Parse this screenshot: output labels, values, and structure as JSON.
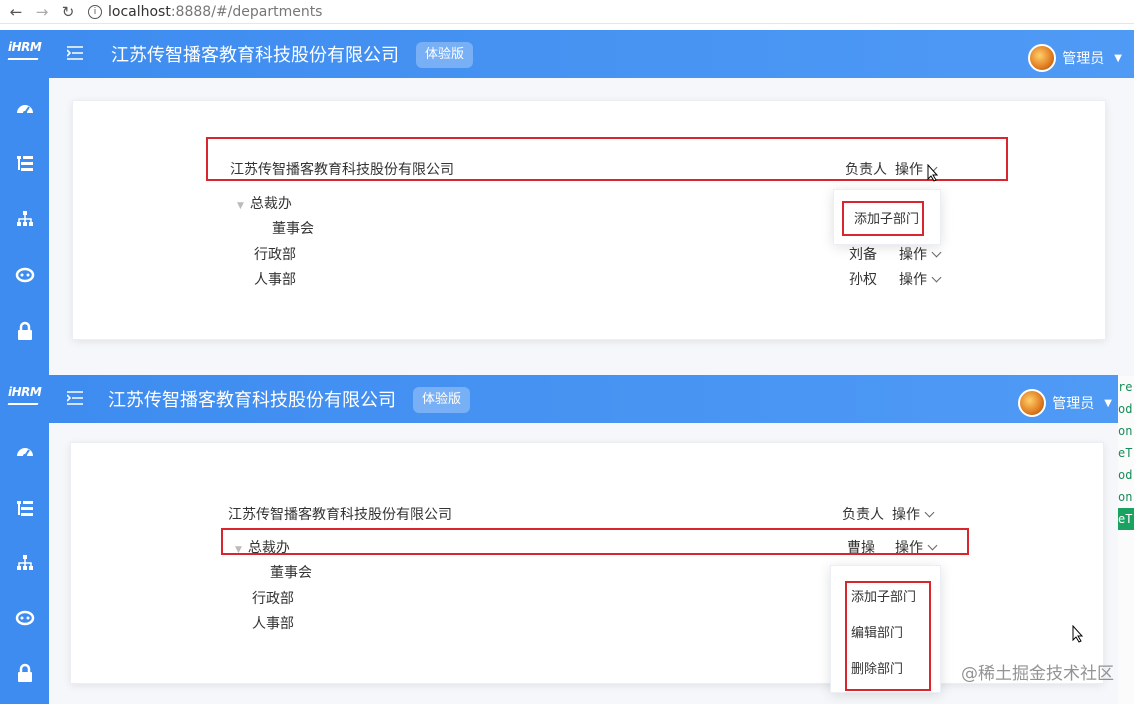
{
  "browser": {
    "back": "←",
    "forward": "→",
    "reload": "↻",
    "url_host": "localhost",
    "url_rest": ":8888/#/departments"
  },
  "app": {
    "logo": "iHRM",
    "company": "江苏传智播客教育科技股份有限公司",
    "trial_badge": "体验版",
    "user": "管理员"
  },
  "tree_header": {
    "name": "江苏传智播客教育科技股份有限公司",
    "manager_label": "负责人",
    "ops_label": "操作"
  },
  "top_view": {
    "rows": [
      {
        "name": "总裁办",
        "manager": "",
        "ops": ""
      },
      {
        "name": "董事会",
        "manager": "",
        "ops": ""
      },
      {
        "name": "行政部",
        "manager": "刘备",
        "ops": "操作"
      },
      {
        "name": "人事部",
        "manager": "孙权",
        "ops": "操作"
      }
    ],
    "dropdown": [
      "添加子部门"
    ]
  },
  "bottom_view": {
    "rows": [
      {
        "name": "总裁办",
        "manager": "曹操",
        "ops": "操作"
      },
      {
        "name": "董事会",
        "manager": "",
        "ops": ""
      },
      {
        "name": "行政部",
        "manager": "",
        "ops": ""
      },
      {
        "name": "人事部",
        "manager": "",
        "ops": ""
      }
    ],
    "dropdown": [
      "添加子部门",
      "编辑部门",
      "删除部门"
    ]
  },
  "watermark": "@稀土掘金技术社区",
  "devtools_fragments": [
    "re",
    "od",
    "on",
    "eT",
    "od",
    "on",
    "eT"
  ],
  "colors": {
    "primary": "#3e8cf0",
    "highlight_box": "#d9262c"
  }
}
